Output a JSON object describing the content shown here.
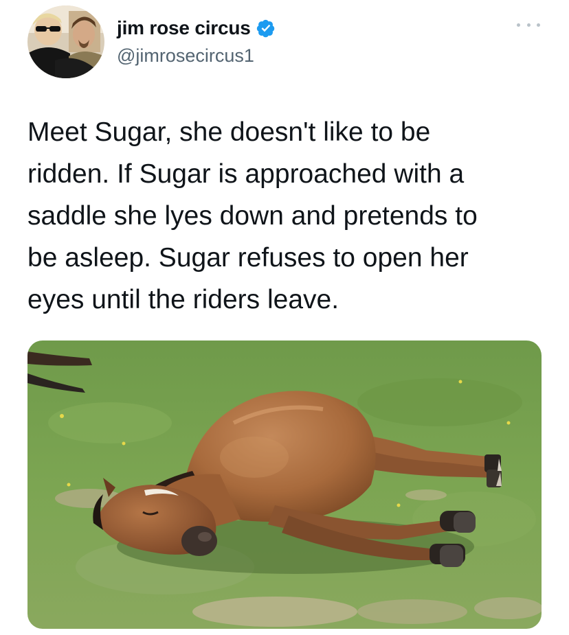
{
  "tweet": {
    "author": {
      "display_name": "jim rose circus",
      "handle": "@jimrosecircus1",
      "verified": true,
      "verified_color": "#1d9bf0"
    },
    "text_lines": [
      "Meet Sugar, she doesn't like to be",
      "ridden. If Sugar is approached with a",
      "saddle she lyes down and pretends to",
      "be asleep. Sugar refuses to open her",
      "eyes until the riders leave."
    ],
    "media": {
      "icon": "photo-of-horse-lying-on-grass"
    },
    "more_icon": "more-options-icon"
  }
}
